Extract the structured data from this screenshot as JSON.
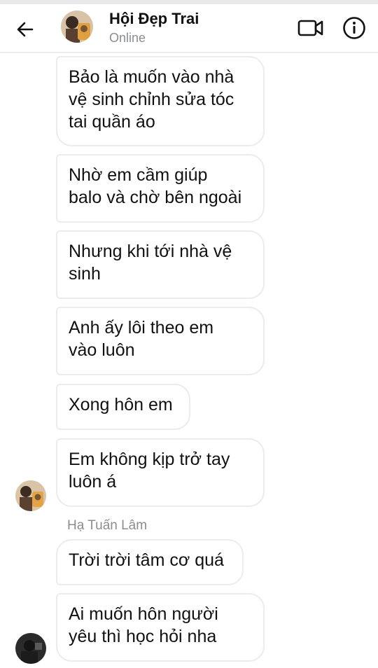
{
  "header": {
    "title": "Hội Đẹp Trai",
    "status": "Online"
  },
  "messages": [
    "Bảo là muốn vào nhà\nvệ sinh chỉnh sửa tóc\ntai quần áo",
    "Nhờ em cầm giúp\nbalo và chờ bên ngoài",
    "Nhưng khi tới nhà vệ\nsinh",
    "Anh ấy lôi theo em\nvào luôn",
    "Xong hôn em",
    "Em không kịp trở tay\nluôn á",
    "Trời trời tâm cơ quá",
    "Ai muốn hôn người\nyêu thì học hỏi nha"
  ],
  "sender_name": "Hạ Tuấn Lâm",
  "icons": {
    "back": "arrow-left-icon",
    "video": "video-camera-icon",
    "info": "info-icon"
  },
  "colors": {
    "bubble_border": "#ececec",
    "secondary_text": "#8a8d91",
    "text": "#111111"
  }
}
